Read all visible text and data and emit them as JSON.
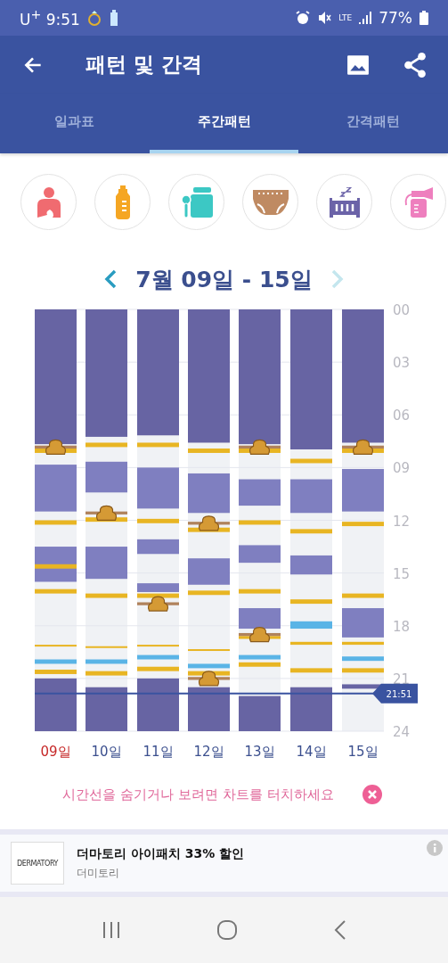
{
  "status_bar": {
    "carrier": "U$^{+}$",
    "time": "9:51",
    "network": "LTE",
    "battery": "77%"
  },
  "app_bar": {
    "title": "패턴 및 간격"
  },
  "tabs": [
    {
      "label": "일과표",
      "selected": false
    },
    {
      "label": "주간패턴",
      "selected": true
    },
    {
      "label": "간격패턴",
      "selected": false
    }
  ],
  "activity_buttons": [
    {
      "kind": "nursing"
    },
    {
      "kind": "bottle"
    },
    {
      "kind": "baby_food"
    },
    {
      "kind": "diaper"
    },
    {
      "kind": "sleep"
    },
    {
      "kind": "pump"
    }
  ],
  "week_nav": {
    "label": "7월 09일 - 15일",
    "next_disabled": true
  },
  "timeline": {
    "hour_labels": [
      "00",
      "03",
      "06",
      "09",
      "12",
      "15",
      "18",
      "21",
      "24"
    ],
    "days": [
      {
        "label": "09일",
        "sunday": true
      },
      {
        "label": "10일",
        "sunday": false
      },
      {
        "label": "11일",
        "sunday": false
      },
      {
        "label": "12일",
        "sunday": false
      },
      {
        "label": "13일",
        "sunday": false
      },
      {
        "label": "14일",
        "sunday": false
      },
      {
        "label": "15일",
        "sunday": false
      }
    ],
    "now": {
      "label": "21:51"
    }
  },
  "hint": {
    "text": "시간선을 숨기거나 보려면 차트를 터치하세요"
  },
  "ad": {
    "logo": "DERMATORY",
    "title": "더마토리 아이패치 33% 할인",
    "advertiser": "더미토리"
  }
}
